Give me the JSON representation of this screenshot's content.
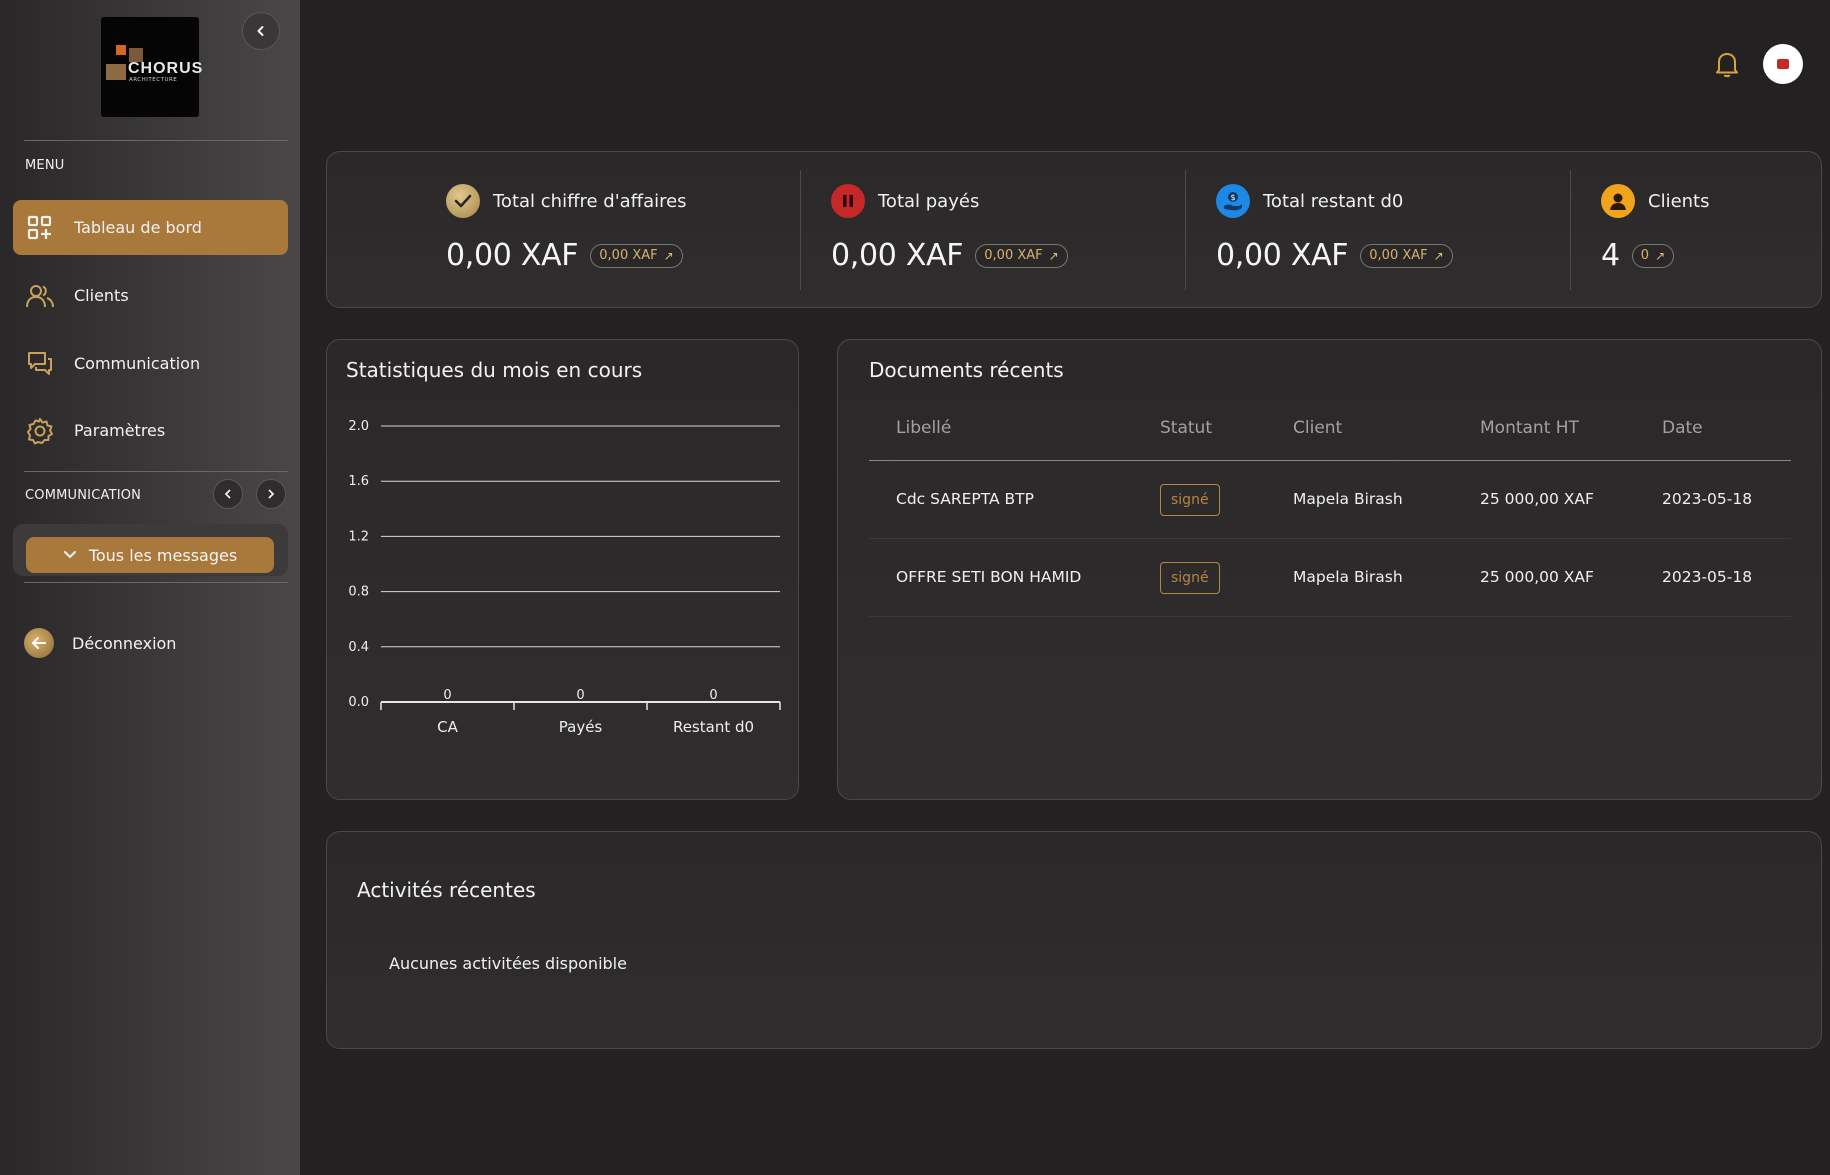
{
  "sidebar": {
    "logo": {
      "word": "CHORUS",
      "sub": "ARCHITECTURE"
    },
    "menu_label": "MENU",
    "items": [
      {
        "label": "Tableau de bord",
        "icon": "dashboard-icon",
        "active": true
      },
      {
        "label": "Clients",
        "icon": "users-icon",
        "active": false
      },
      {
        "label": "Communication",
        "icon": "chat-icon",
        "active": false
      },
      {
        "label": "Paramètres",
        "icon": "gear-icon",
        "active": false
      }
    ],
    "communication_label": "COMMUNICATION",
    "messages_button": "Tous les messages",
    "logout_label": "Déconnexion"
  },
  "colors": {
    "accent": "#a8793a",
    "status": "#b4873f",
    "paid_icon": "#c62828",
    "remaining_icon": "#1e88e5",
    "clients_icon": "#f0a41c"
  },
  "kpis": [
    {
      "label": "Total chiffre d'affaires",
      "value": "0,00 XAF",
      "delta": "0,00 XAF",
      "icon": "check-icon"
    },
    {
      "label": "Total payés",
      "value": "0,00 XAF",
      "delta": "0,00 XAF",
      "icon": "pause-icon"
    },
    {
      "label": "Total restant d0",
      "value": "0,00 XAF",
      "delta": "0,00 XAF",
      "icon": "money-hand-icon"
    },
    {
      "label": "Clients",
      "value": "4",
      "delta": "0",
      "icon": "user-icon"
    }
  ],
  "stats": {
    "title": "Statistiques du mois en cours"
  },
  "chart_data": {
    "type": "bar",
    "title": "Statistiques du mois en cours",
    "categories": [
      "CA",
      "Payés",
      "Restant d0"
    ],
    "values": [
      0,
      0,
      0
    ],
    "data_labels": [
      "0",
      "0",
      "0"
    ],
    "yticks": [
      "0.0",
      "0.4",
      "0.8",
      "1.2",
      "1.6",
      "2.0"
    ],
    "ylim": [
      0,
      2.0
    ],
    "grid": true,
    "legend": "none"
  },
  "documents": {
    "title": "Documents récents",
    "columns": [
      "Libellé",
      "Statut",
      "Client",
      "Montant HT",
      "Date"
    ],
    "rows": [
      {
        "label": "Cdc SAREPTA BTP",
        "status": "signé",
        "client": "Mapela Birash",
        "amount": "25 000,00 XAF",
        "date": "2023-05-18"
      },
      {
        "label": "OFFRE SETI BON HAMID",
        "status": "signé",
        "client": "Mapela Birash",
        "amount": "25 000,00 XAF",
        "date": "2023-05-18"
      }
    ]
  },
  "activities": {
    "title": "Activités récentes",
    "empty": "Aucunes activitées disponible"
  }
}
